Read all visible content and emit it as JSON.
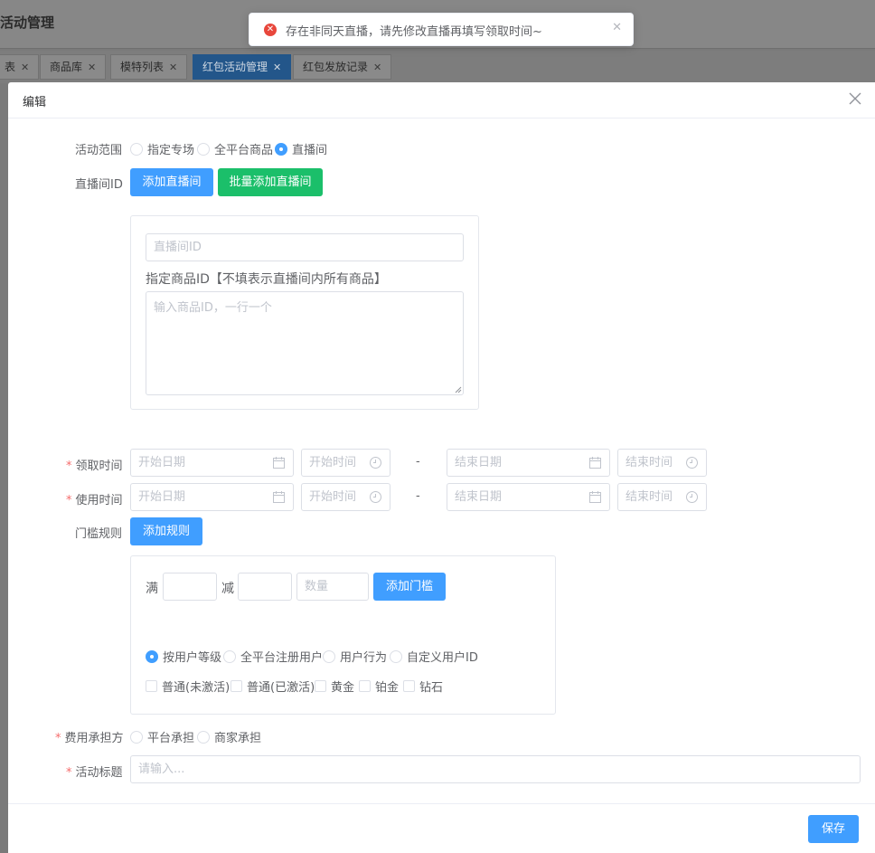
{
  "app": {
    "title": "活动管理",
    "tabs": [
      {
        "label": "表",
        "active": false
      },
      {
        "label": "商品库",
        "active": false
      },
      {
        "label": "模特列表",
        "active": false
      },
      {
        "label": "红包活动管理",
        "active": true
      },
      {
        "label": "红包发放记录",
        "active": false
      }
    ]
  },
  "toast": {
    "message": "存在非同天直播，请先修改直播再填写领取时间~",
    "type": "error",
    "color": "#e8473c"
  },
  "dialog": {
    "title": "编辑",
    "scope": {
      "label": "活动范围",
      "options": [
        "指定专场",
        "全平台商品",
        "直播间"
      ],
      "selected": "直播间"
    },
    "live_room": {
      "label": "直播间ID",
      "add_button": "添加直播间",
      "batch_add_button": "批量添加直播间",
      "id_placeholder": "直播间ID",
      "product_label": "指定商品ID【不填表示直播间内所有商品】",
      "product_placeholder": "输入商品ID，一行一个"
    },
    "claim_time": {
      "label": "领取时间",
      "required": true,
      "start_date": "开始日期",
      "start_time": "开始时间",
      "separator": "-",
      "end_date": "结束日期",
      "end_time": "结束时间"
    },
    "use_time": {
      "label": "使用时间",
      "required": true,
      "start_date": "开始日期",
      "start_time": "开始时间",
      "separator": "-",
      "end_date": "结束日期",
      "end_time": "结束时间"
    },
    "threshold": {
      "label": "门槛规则",
      "add_rule_button": "添加规则",
      "full_label": "满",
      "minus_label": "减",
      "quantity_placeholder": "数量",
      "add_threshold_button": "添加门槛",
      "user_options": [
        "按用户等级",
        "全平台注册用户",
        "用户行为",
        "自定义用户ID"
      ],
      "user_selected": "按用户等级",
      "levels": [
        "普通(未激活)",
        "普通(已激活)",
        "黄金",
        "铂金",
        "钻石"
      ]
    },
    "cost": {
      "label": "费用承担方",
      "required": true,
      "options": [
        "平台承担",
        "商家承担"
      ]
    },
    "title_field": {
      "label": "活动标题",
      "required": true,
      "placeholder": "请输入..."
    },
    "save_button": "保存"
  },
  "colors": {
    "primary": "#409eff",
    "success": "#1bbf6a",
    "required": "#f56c6c"
  }
}
